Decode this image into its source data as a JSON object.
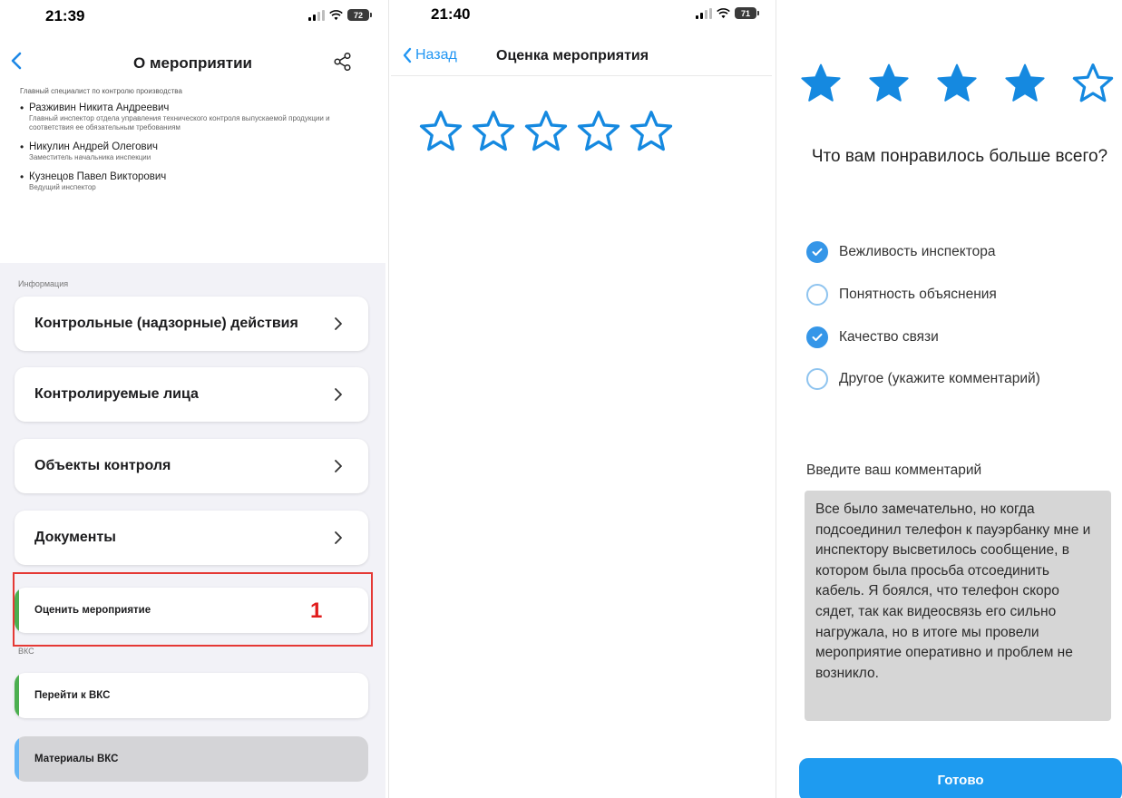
{
  "screen1": {
    "status": {
      "time": "21:39",
      "battery": "72"
    },
    "nav": {
      "title": "О мероприятии"
    },
    "inspectors": {
      "first_role": "Главный специалист по контролю производства",
      "items": [
        {
          "name": "Разживин Никита Андреевич",
          "role": "Главный инспектор отдела управления технического контроля выпускаемой продукции и соответствия ее обязательным требованиям"
        },
        {
          "name": "Никулин Андрей Олегович",
          "role": "Заместитель начальника инспекции"
        },
        {
          "name": "Кузнецов Павел Викторович",
          "role": "Ведущий инспектор"
        }
      ]
    },
    "info_section": {
      "label": "Информация",
      "items": [
        "Контрольные (надзорные) действия",
        "Контролируемые лица",
        "Объекты контроля",
        "Документы"
      ]
    },
    "rate_button": "Оценить мероприятие",
    "annotation_number": "1",
    "vks_section": {
      "label": "ВКС",
      "go_button": "Перейти к ВКС",
      "materials_button": "Материалы ВКС"
    }
  },
  "screen2": {
    "status": {
      "time": "21:40",
      "battery": "71"
    },
    "nav": {
      "back_label": "Назад",
      "title": "Оценка мероприятия"
    },
    "rating": {
      "value": 0,
      "max": 5
    }
  },
  "screen3": {
    "rating": {
      "value": 4,
      "max": 5
    },
    "question": "Что вам понравилось больше всего?",
    "options": [
      {
        "label": "Вежливость инспектора",
        "checked": true
      },
      {
        "label": "Понятность объяснения",
        "checked": false
      },
      {
        "label": "Качество связи",
        "checked": true
      },
      {
        "label": "Другое (укажите комментарий)",
        "checked": false
      }
    ],
    "comment_label": "Введите ваш комментарий",
    "comment_value": "Все было замечательно, но когда подсоединил телефон к пауэрбанку мне и инспектору высветилось сообщение, в котором была просьба отсоединить кабель. Я боялся, что телефон скоро сядет, так как видеосвязь его сильно нагружала, но в итоге мы провели мероприятие оперативно и проблем не возникло.",
    "done_button": "Готово"
  },
  "colors": {
    "accent_blue": "#1e9bf0",
    "star_blue": "#1589e0",
    "accent_green": "#4caf50",
    "accent_light_blue": "#64b5f6",
    "highlight_red": "#e53935"
  },
  "icons": [
    "back-chevron-icon",
    "share-icon",
    "chevron-right-icon",
    "star-icon",
    "checkmark-icon",
    "signal-icon",
    "wifi-icon",
    "battery-icon"
  ]
}
